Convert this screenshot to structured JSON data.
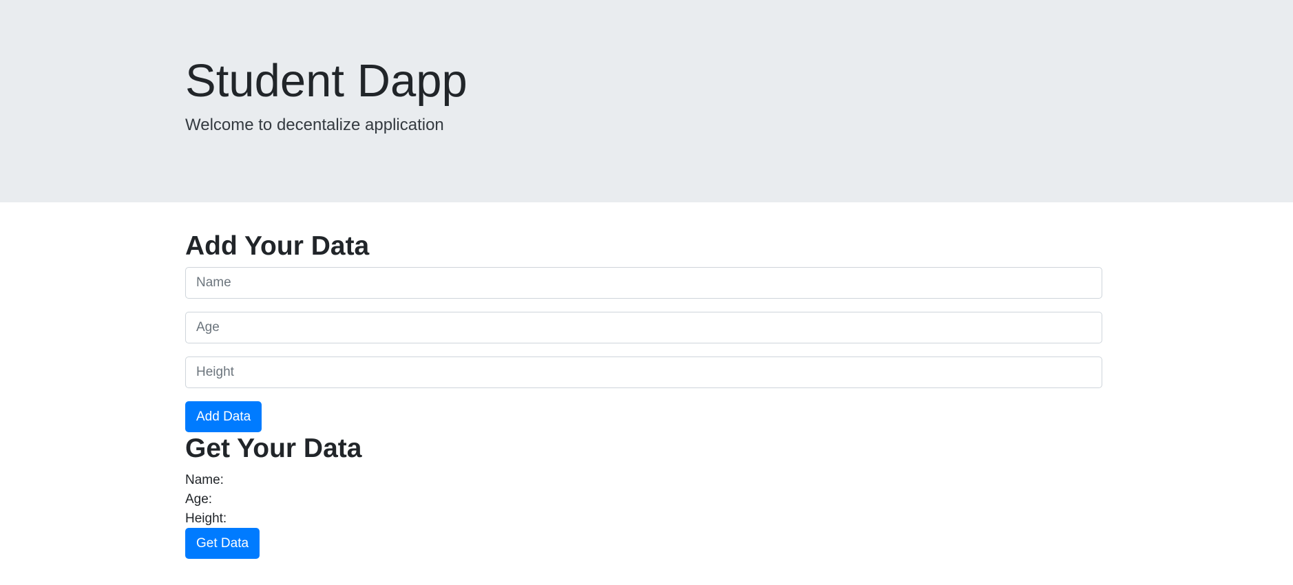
{
  "header": {
    "title": "Student Dapp",
    "subtitle": "Welcome to decentalize application"
  },
  "add_section": {
    "heading": "Add Your Data",
    "name_field": {
      "placeholder": "Name",
      "value": ""
    },
    "age_field": {
      "placeholder": "Age",
      "value": ""
    },
    "height_field": {
      "placeholder": "Height",
      "value": ""
    },
    "button_label": "Add Data"
  },
  "get_section": {
    "heading": "Get Your Data",
    "name_label": "Name:",
    "name_value": "",
    "age_label": "Age:",
    "age_value": "",
    "height_label": "Height:",
    "height_value": "",
    "button_label": "Get Data"
  },
  "colors": {
    "jumbotron_bg": "#e9ecef",
    "primary": "#007bff",
    "text": "#212529"
  }
}
